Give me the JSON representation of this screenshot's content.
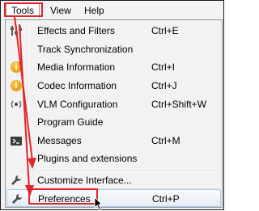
{
  "menubar": {
    "tools": "Tools",
    "view": "View",
    "help": "Help"
  },
  "menu": {
    "items": [
      {
        "label": "Effects and Filters",
        "shortcut": "Ctrl+E",
        "icon": "sliders-icon"
      },
      {
        "label": "Track Synchronization",
        "shortcut": "",
        "icon": ""
      },
      {
        "label": "Media Information",
        "shortcut": "Ctrl+I",
        "icon": "info-icon"
      },
      {
        "label": "Codec Information",
        "shortcut": "Ctrl+J",
        "icon": "info-icon"
      },
      {
        "label": "VLM Configuration",
        "shortcut": "Ctrl+Shift+W",
        "icon": "broadcast-icon"
      },
      {
        "label": "Program Guide",
        "shortcut": "",
        "icon": ""
      },
      {
        "label": "Messages",
        "shortcut": "Ctrl+M",
        "icon": "terminal-icon"
      },
      {
        "label": "Plugins and extensions",
        "shortcut": "",
        "icon": ""
      },
      {
        "label": "Customize Interface...",
        "shortcut": "",
        "icon": "wrench-icon"
      },
      {
        "label": "Preferences",
        "shortcut": "Ctrl+P",
        "icon": "wrench-icon"
      }
    ]
  },
  "colors": {
    "highlight_red": "#e0262b",
    "info_orange": "#e8920b",
    "selection_border": "#aecbe9"
  }
}
